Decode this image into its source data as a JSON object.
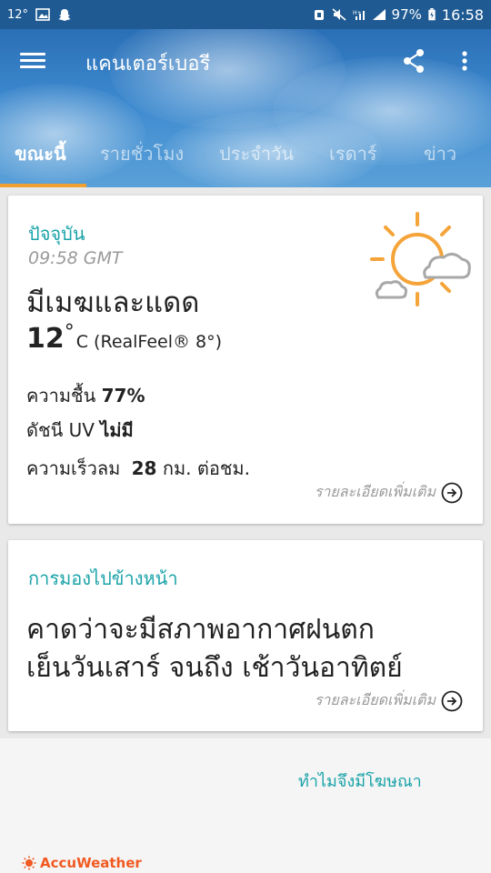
{
  "status_bar": {
    "temp": "12°",
    "battery": "97%",
    "time": "16:58",
    "bg_color": "#1f5a93"
  },
  "toolbar": {
    "title": "แคนเตอร์เบอรี",
    "icons": [
      "menu-icon",
      "share-icon",
      "more-vert-icon"
    ]
  },
  "tabs": [
    {
      "label": "ขณะนี้",
      "active": true
    },
    {
      "label": "รายชั่วโมง",
      "active": false
    },
    {
      "label": "ประจำวัน",
      "active": false
    },
    {
      "label": "เรดาร์",
      "active": false
    },
    {
      "label": "ข่าว",
      "active": false
    }
  ],
  "current": {
    "section_label": "ปัจจุบัน",
    "time": "09:58 GMT",
    "condition": "มีเมฆและแดด",
    "temp": "12",
    "temp_unit": "C (RealFeel® 8°)",
    "humidity_label": "ความชื้น",
    "humidity_value": "77%",
    "uv_label": "ดัชนี UV",
    "uv_value": "ไม่มี",
    "wind_label": "ความเร็วลม",
    "wind_value": "28",
    "wind_unit": "กม. ต่อชม.",
    "more_label": "รายละเอียดเพิ่มเติม",
    "icon": "partly-sunny-icon"
  },
  "outlook": {
    "section_label": "การมองไปข้างหน้า",
    "line1": "คาดว่าจะมีสภาพอากาศฝนตก",
    "line2": "เย็นวันเสาร์ จนถึง เช้าวันอาทิตย์",
    "more_label": "รายละเอียดเพิ่มเติม"
  },
  "ad": {
    "why_label": "ทำไมจึงมีโฆษณา",
    "brand": "AccuWeather"
  },
  "colors": {
    "accent_teal": "#1aa3a9",
    "tab_indicator": "#f0a030",
    "sun_orange": "#f5a43a",
    "brand_orange": "#f15a22"
  }
}
